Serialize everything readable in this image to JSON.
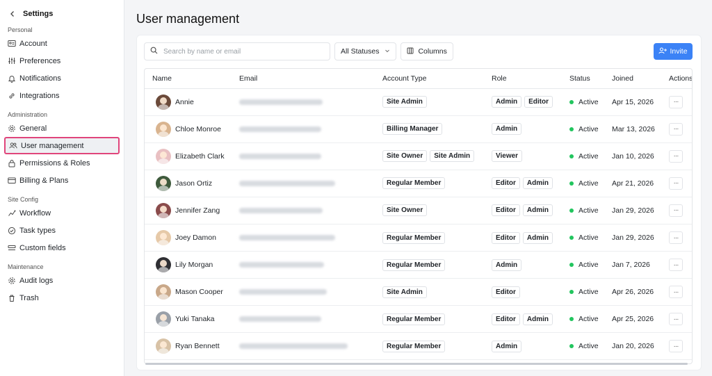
{
  "sidebar": {
    "title": "Settings",
    "sections": [
      {
        "label": "Personal",
        "items": [
          {
            "label": "Account",
            "icon": "id-card-icon"
          },
          {
            "label": "Preferences",
            "icon": "sliders-icon"
          },
          {
            "label": "Notifications",
            "icon": "bell-icon"
          },
          {
            "label": "Integrations",
            "icon": "link-icon"
          }
        ]
      },
      {
        "label": "Administration",
        "items": [
          {
            "label": "General",
            "icon": "gear-icon"
          },
          {
            "label": "User management",
            "icon": "users-icon",
            "active": true
          },
          {
            "label": "Permissions & Roles",
            "icon": "lock-icon"
          },
          {
            "label": "Billing & Plans",
            "icon": "credit-card-icon"
          }
        ]
      },
      {
        "label": "Site Config",
        "items": [
          {
            "label": "Workflow",
            "icon": "workflow-icon"
          },
          {
            "label": "Task types",
            "icon": "check-circle-icon"
          },
          {
            "label": "Custom fields",
            "icon": "custom-fields-icon"
          }
        ]
      },
      {
        "label": "Maintenance",
        "items": [
          {
            "label": "Audit logs",
            "icon": "gear-icon"
          },
          {
            "label": "Trash",
            "icon": "trash-icon"
          }
        ]
      }
    ]
  },
  "page": {
    "title": "User management"
  },
  "toolbar": {
    "search_placeholder": "Search by name or email",
    "status_filter": "All Statuses",
    "columns_label": "Columns",
    "invite_label": "Invite"
  },
  "table": {
    "columns": [
      "Name",
      "Email",
      "Account Type",
      "Role",
      "Status",
      "Joined",
      "Actions"
    ],
    "rows": [
      {
        "name": "Annie",
        "account_types": [
          "Site Admin"
        ],
        "roles": [
          "Admin",
          "Editor"
        ],
        "status": "Active",
        "joined": "Apr 15, 2026"
      },
      {
        "name": "Chloe Monroe",
        "account_types": [
          "Billing Manager"
        ],
        "roles": [
          "Admin"
        ],
        "status": "Active",
        "joined": "Mar 13, 2026"
      },
      {
        "name": "Elizabeth Clark",
        "account_types": [
          "Site Owner",
          "Site Admin"
        ],
        "roles": [
          "Viewer"
        ],
        "status": "Active",
        "joined": "Jan 10, 2026"
      },
      {
        "name": "Jason Ortiz",
        "account_types": [
          "Regular Member"
        ],
        "roles": [
          "Editor",
          "Admin"
        ],
        "status": "Active",
        "joined": "Apr 21, 2026"
      },
      {
        "name": "Jennifer Zang",
        "account_types": [
          "Site Owner"
        ],
        "roles": [
          "Editor",
          "Admin"
        ],
        "status": "Active",
        "joined": "Jan 29, 2026"
      },
      {
        "name": "Joey Damon",
        "account_types": [
          "Regular Member"
        ],
        "roles": [
          "Editor",
          "Admin"
        ],
        "status": "Active",
        "joined": "Jan 29, 2026"
      },
      {
        "name": "Lily Morgan",
        "account_types": [
          "Regular Member"
        ],
        "roles": [
          "Admin"
        ],
        "status": "Active",
        "joined": "Jan 7, 2026"
      },
      {
        "name": "Mason Cooper",
        "account_types": [
          "Site Admin"
        ],
        "roles": [
          "Editor"
        ],
        "status": "Active",
        "joined": "Apr 26, 2026"
      },
      {
        "name": "Yuki Tanaka",
        "account_types": [
          "Regular Member"
        ],
        "roles": [
          "Editor",
          "Admin"
        ],
        "status": "Active",
        "joined": "Apr 25, 2026"
      },
      {
        "name": "Ryan Bennett",
        "account_types": [
          "Regular Member"
        ],
        "roles": [
          "Admin"
        ],
        "status": "Active",
        "joined": "Jan 20, 2026"
      }
    ]
  },
  "colors": {
    "accent": "#3b82f6",
    "active_highlight": "#e0457b",
    "status_active": "#22c55e"
  }
}
